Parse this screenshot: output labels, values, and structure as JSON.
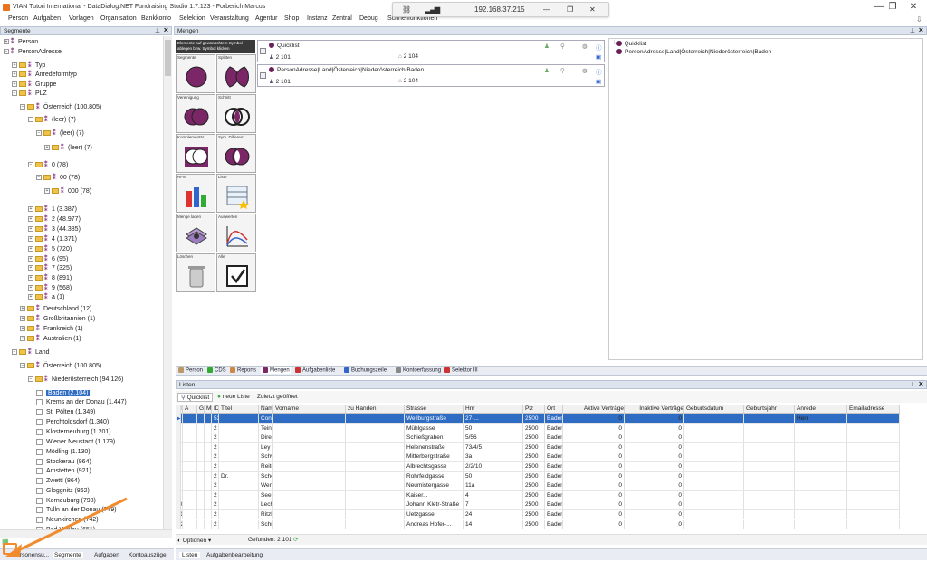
{
  "window": {
    "title": "VIAN Tutori International - DataDialog.NET Fundraising Studio 1.7.123 - Forberich Marcus",
    "min": "—",
    "max": "❐",
    "close": "✕"
  },
  "network": {
    "ip": "192.168.37.215",
    "minimize": "—",
    "restore": "❐",
    "close": "✕"
  },
  "menu": [
    "Person",
    "Aufgaben",
    "Vorlagen",
    "Organisation",
    "Bankkonto",
    "Selektion",
    "Veranstaltung",
    "Agentur",
    "Shop",
    "Instanz",
    "Zentral",
    "Debug",
    "Schnellfunktionen"
  ],
  "segmente": {
    "title": "Segmente",
    "nodes": [
      {
        "label": "Person",
        "pm": "+",
        "level": 0,
        "kind": "seg"
      },
      {
        "label": "PersonAdresse",
        "pm": "−",
        "level": 0,
        "kind": "seg"
      },
      {
        "label": "Typ",
        "pm": "+",
        "level": 1,
        "kind": "folder"
      },
      {
        "label": "Anredeformtyp",
        "pm": "+",
        "level": 1,
        "kind": "folder"
      },
      {
        "label": "Gruppe",
        "pm": "+",
        "level": 1,
        "kind": "folder"
      },
      {
        "label": "PLZ",
        "pm": "−",
        "level": 1,
        "kind": "folder"
      },
      {
        "label": "Österreich (100.805)",
        "pm": "−",
        "level": 2,
        "kind": "folder"
      },
      {
        "label": "(leer) (7)",
        "pm": "−",
        "level": 3,
        "kind": "folder"
      },
      {
        "label": "(leer) (7)",
        "pm": "−",
        "level": 4,
        "kind": "folder"
      },
      {
        "label": "(leer) (7)",
        "pm": "+",
        "level": 5,
        "kind": "folder"
      },
      {
        "label": "0 (78)",
        "pm": "−",
        "level": 3,
        "kind": "folder"
      },
      {
        "label": "00 (78)",
        "pm": "−",
        "level": 4,
        "kind": "folder"
      },
      {
        "label": "000 (78)",
        "pm": "+",
        "level": 5,
        "kind": "folder"
      },
      {
        "label": "1 (3.387)",
        "pm": "+",
        "level": 3,
        "kind": "folder"
      },
      {
        "label": "2 (48.977)",
        "pm": "+",
        "level": 3,
        "kind": "folder"
      },
      {
        "label": "3 (44.385)",
        "pm": "+",
        "level": 3,
        "kind": "folder"
      },
      {
        "label": "4 (1.371)",
        "pm": "+",
        "level": 3,
        "kind": "folder"
      },
      {
        "label": "5 (720)",
        "pm": "+",
        "level": 3,
        "kind": "folder"
      },
      {
        "label": "6 (95)",
        "pm": "+",
        "level": 3,
        "kind": "folder"
      },
      {
        "label": "7 (325)",
        "pm": "+",
        "level": 3,
        "kind": "folder"
      },
      {
        "label": "8 (891)",
        "pm": "+",
        "level": 3,
        "kind": "folder"
      },
      {
        "label": "9 (568)",
        "pm": "+",
        "level": 3,
        "kind": "folder"
      },
      {
        "label": "a (1)",
        "pm": "+",
        "level": 3,
        "kind": "folder"
      },
      {
        "label": "Deutschland (12)",
        "pm": "+",
        "level": 2,
        "kind": "folder"
      },
      {
        "label": "Großbritannien (1)",
        "pm": "+",
        "level": 2,
        "kind": "folder"
      },
      {
        "label": "Frankreich (1)",
        "pm": "+",
        "level": 2,
        "kind": "folder"
      },
      {
        "label": "Australien (1)",
        "pm": "+",
        "level": 2,
        "kind": "folder"
      },
      {
        "label": "Land",
        "pm": "−",
        "level": 1,
        "kind": "folder"
      },
      {
        "label": "Österreich (100.805)",
        "pm": "−",
        "level": 2,
        "kind": "folder"
      },
      {
        "label": "Niederösterreich (94.126)",
        "pm": "−",
        "level": 3,
        "kind": "folder"
      },
      {
        "label": "Baden (2.104)",
        "level": 4,
        "kind": "check",
        "selected": true
      },
      {
        "label": "Krems an der Donau (1.447)",
        "level": 4,
        "kind": "check"
      },
      {
        "label": "St. Pölten (1.349)",
        "level": 4,
        "kind": "check"
      },
      {
        "label": "Perchtoldsdorf (1.340)",
        "level": 4,
        "kind": "check"
      },
      {
        "label": "Klosterneuburg (1.201)",
        "level": 4,
        "kind": "check"
      },
      {
        "label": "Wiener Neustadt (1.179)",
        "level": 4,
        "kind": "check"
      },
      {
        "label": "Mödling (1.130)",
        "level": 4,
        "kind": "check"
      },
      {
        "label": "Stockerau (964)",
        "level": 4,
        "kind": "check"
      },
      {
        "label": "Amstetten (921)",
        "level": 4,
        "kind": "check"
      },
      {
        "label": "Zwettl (864)",
        "level": 4,
        "kind": "check"
      },
      {
        "label": "Gloggnitz (862)",
        "level": 4,
        "kind": "check"
      },
      {
        "label": "Korneuburg (798)",
        "level": 4,
        "kind": "check"
      },
      {
        "label": "Tulln an der Donau (779)",
        "level": 4,
        "kind": "check"
      },
      {
        "label": "Neunkirchen (742)",
        "level": 4,
        "kind": "check"
      },
      {
        "label": "Bad Vöslau (651)",
        "level": 4,
        "kind": "check"
      }
    ],
    "bottom_tabs": [
      "Personensu...",
      "Segmente",
      "Aufgaben",
      "Kontoauszüge"
    ]
  },
  "mengen": {
    "title": "Mengen",
    "hint": "Elemente auf gewünschtem Symbol ablegen bzw. Symbol klicken",
    "tools": [
      "Segmente",
      "Splitten",
      "Vereinigung",
      "Schnitt",
      "Komplementär",
      "Sym. Differenz",
      "RFM",
      "Liste",
      "Menge laden",
      "Auswerten",
      "Löschen",
      "Alle"
    ],
    "sets": [
      {
        "name": "Quicklist",
        "count_a": "2 101",
        "count_b": "2 104"
      },
      {
        "name": "PersonAdresse|Land|Österreich|Niederösterreich|Baden",
        "count_a": "2 101",
        "count_b": "2 104"
      }
    ],
    "result_list": [
      "Quicklist",
      "PersonAdresse|Land|Österreich|Niederösterreich|Baden"
    ]
  },
  "middle_tabs": [
    "Person",
    "CDS",
    "Reports",
    "Mengen",
    "Aufgabenliste",
    "Buchungszeile",
    "Kontoerfassung",
    "Selektor III"
  ],
  "listen": {
    "title": "Listen",
    "subtabs": [
      "Quicklist",
      "neue Liste",
      "Zuletzt geöffnet"
    ],
    "columns": [
      "Nr.",
      "A",
      "G",
      "M",
      "ID",
      "Titel",
      "Name",
      "Vorname",
      "zu Handen",
      "Strasse",
      "Hnr",
      "Plz",
      "Ort",
      "Aktive Verträge",
      "Inaktive Verträge",
      "Geburtsdatum",
      "Geburtsjahr",
      "Anrede",
      "Emailadresse"
    ],
    "rows": [
      [
        "1",
        "",
        "",
        "",
        "53",
        "",
        "Constantine...",
        "",
        "",
        "Weilburgstraße",
        "27-...",
        "2500",
        "Baden",
        "0",
        "0",
        "",
        "",
        "Herr",
        ""
      ],
      [
        "2",
        "",
        "",
        "",
        "2 162 024",
        "",
        "Teinitzer",
        "",
        "",
        "Mühlgasse",
        "50",
        "2500",
        "Baden Bei Wien",
        "0",
        "0",
        "",
        "",
        "",
        ""
      ],
      [
        "3",
        "",
        "",
        "",
        "2 162 066",
        "",
        "Direder",
        "",
        "",
        "Schießgraben",
        "5/56",
        "2500",
        "Baden",
        "0",
        "0",
        "",
        "",
        "",
        ""
      ],
      [
        "4",
        "",
        "",
        "",
        "2 162 230",
        "",
        "Ley",
        "",
        "",
        "Helenenstraße",
        "73/4/5",
        "2500",
        "Baden",
        "0",
        "0",
        "",
        "",
        "",
        ""
      ],
      [
        "5",
        "",
        "",
        "",
        "2 162 566",
        "",
        "Schwarzkogler",
        "",
        "",
        "Mitterbergstraße",
        "3a",
        "2500",
        "Baden",
        "0",
        "0",
        "",
        "",
        "",
        ""
      ],
      [
        "6",
        "",
        "",
        "",
        "2 162 652",
        "",
        "Reiter",
        "",
        "",
        "Albrechtsgasse",
        "2/2/10",
        "2500",
        "Baden",
        "0",
        "0",
        "",
        "",
        "",
        ""
      ],
      [
        "7",
        "",
        "",
        "",
        "2 162 910",
        "Dr.",
        "Schöberl",
        "",
        "",
        "Rohrfeldgasse",
        "50",
        "2500",
        "Baden",
        "0",
        "0",
        "",
        "",
        "",
        ""
      ],
      [
        "8",
        "",
        "",
        "",
        "2 163 108",
        "",
        "Weninger",
        "",
        "",
        "Neumistergasse",
        "11a",
        "2500",
        "Baden",
        "0",
        "0",
        "",
        "",
        "",
        ""
      ],
      [
        "9",
        "",
        "",
        "",
        "2 163 900",
        "",
        "Seekircher",
        "",
        "",
        "Kaiser...",
        "4",
        "2500",
        "Baden bei Wien",
        "0",
        "0",
        "",
        "",
        "",
        ""
      ],
      [
        "10",
        "",
        "",
        "",
        "2 164 105",
        "",
        "Lechner",
        "",
        "",
        "Johann Kletr-Straße",
        "7",
        "2500",
        "Baden",
        "0",
        "0",
        "",
        "",
        "",
        ""
      ],
      [
        "11",
        "",
        "",
        "",
        "2 164 883",
        "",
        "Ritzlmayr",
        "",
        "",
        "Uetzgasse",
        "24",
        "2500",
        "Baden",
        "0",
        "0",
        "",
        "",
        "",
        ""
      ],
      [
        "12",
        "",
        "",
        "",
        "2 165 062",
        "",
        "Schrenz",
        "",
        "",
        "Andreas Hofer-...",
        "14",
        "2500",
        "Baden",
        "0",
        "0",
        "",
        "",
        "",
        ""
      ]
    ],
    "options_label": "Optionen",
    "found_label": "Gefunden: 2 101",
    "bottom_tabs": [
      "Listen",
      "Aufgabenbearbeitung"
    ]
  }
}
